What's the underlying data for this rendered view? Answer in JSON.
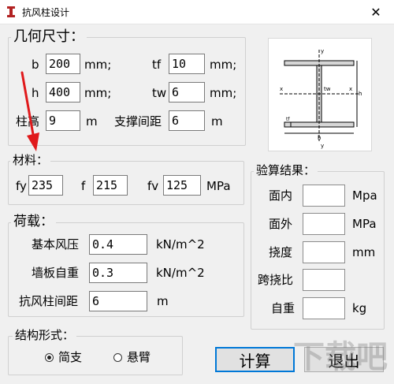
{
  "window": {
    "title": "抗风柱设计",
    "close_glyph": "✕"
  },
  "geometry": {
    "title": "几何尺寸：",
    "b_label": "b",
    "b_value": "200",
    "b_unit": "mm;",
    "tf_label": "tf",
    "tf_value": "10",
    "tf_unit": "mm;",
    "h_label": "h",
    "h_value": "400",
    "h_unit": "mm;",
    "tw_label": "tw",
    "tw_value": "6",
    "tw_unit": "mm;",
    "height_label": "柱高",
    "height_value": "9",
    "height_unit": "m",
    "brace_label": "支撑间距",
    "brace_value": "6",
    "brace_unit": "m"
  },
  "material": {
    "title": "材料：",
    "fy_label": "fy",
    "fy_value": "235",
    "f_label": "f",
    "f_value": "215",
    "fv_label": "fv",
    "fv_value": "125",
    "unit": "MPa"
  },
  "load": {
    "title": "荷载：",
    "wind_label": "基本风压",
    "wind_value": "0.4",
    "wind_unit": "kN/m^2",
    "wall_label": "墙板自重",
    "wall_value": "0.3",
    "wall_unit": "kN/m^2",
    "spacing_label": "抗风柱间距",
    "spacing_value": "6",
    "spacing_unit": "m"
  },
  "results": {
    "title": "验算结果：",
    "in_plane_label": "面内",
    "in_plane_unit": "Mpa",
    "out_plane_label": "面外",
    "out_plane_unit": "MPa",
    "deflection_label": "挠度",
    "deflection_unit": "mm",
    "ratio_label": "跨挠比",
    "self_weight_label": "自重",
    "self_weight_unit": "kg"
  },
  "structure": {
    "title": "结构形式：",
    "simple_label": "简支",
    "simple_selected": true,
    "cantilever_label": "悬臂",
    "cantilever_selected": false
  },
  "buttons": {
    "calculate": "计算",
    "exit": "退出"
  },
  "diagram": {
    "y_top": "y",
    "y_bottom": "y",
    "x_left": "x",
    "x_right": "x",
    "tw": "tw",
    "tf": "tf",
    "h": "h",
    "b": "b"
  },
  "watermark": "下载吧",
  "colors": {
    "annotation_arrow": "#e0191b",
    "default_button_border": "#0078d7"
  }
}
